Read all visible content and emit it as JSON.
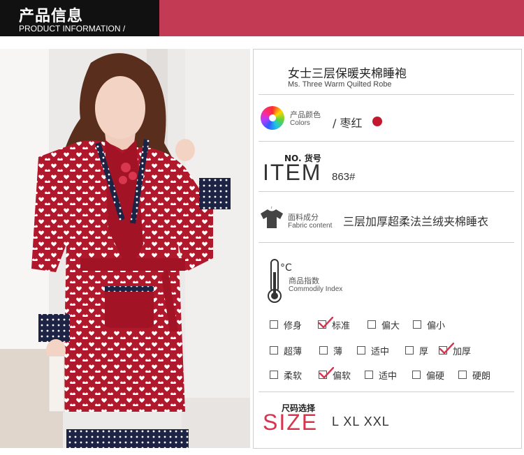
{
  "header": {
    "title_cn": "产品信息",
    "title_en": "PRODUCT INFORMATION /",
    "colors": {
      "black_block": "#111111",
      "red_bar": "#c23a53"
    }
  },
  "product": {
    "name_cn": "女士三层保暖夹棉睡袍",
    "name_en": "Ms. Three Warm Quilted Robe"
  },
  "color": {
    "label_cn": "产品颜色",
    "label_en": "Colors",
    "value": "/ 枣红",
    "swatch": "#c4182f",
    "icon": "color-wheel-icon"
  },
  "item": {
    "label_no": "NO. 货号",
    "label_big": "ITEM",
    "number": "863#"
  },
  "fabric": {
    "label_cn": "面料成分",
    "label_en": "Fabric content",
    "value": "三层加厚超柔法兰绒夹棉睡衣",
    "icon": "shirt-icon"
  },
  "comfort": {
    "label_cn": "商品指数",
    "label_en": "Commodily Index",
    "icon": "thermometer-icon",
    "rows": [
      {
        "options": [
          {
            "label": "修身",
            "checked": false
          },
          {
            "label": "标准",
            "checked": true
          },
          {
            "label": "偏大",
            "checked": false
          },
          {
            "label": "偏小",
            "checked": false
          }
        ]
      },
      {
        "options": [
          {
            "label": "超薄",
            "checked": false
          },
          {
            "label": "薄",
            "checked": false
          },
          {
            "label": "适中",
            "checked": false
          },
          {
            "label": "厚",
            "checked": false
          },
          {
            "label": "加厚",
            "checked": true
          }
        ]
      },
      {
        "options": [
          {
            "label": "柔软",
            "checked": false
          },
          {
            "label": "偏软",
            "checked": true
          },
          {
            "label": "适中",
            "checked": false
          },
          {
            "label": "偏硬",
            "checked": false
          },
          {
            "label": "硬朗",
            "checked": false
          }
        ]
      }
    ]
  },
  "size": {
    "label_cn": "尺码选择",
    "label_big": "SIZE",
    "values": "L XL XXL"
  }
}
